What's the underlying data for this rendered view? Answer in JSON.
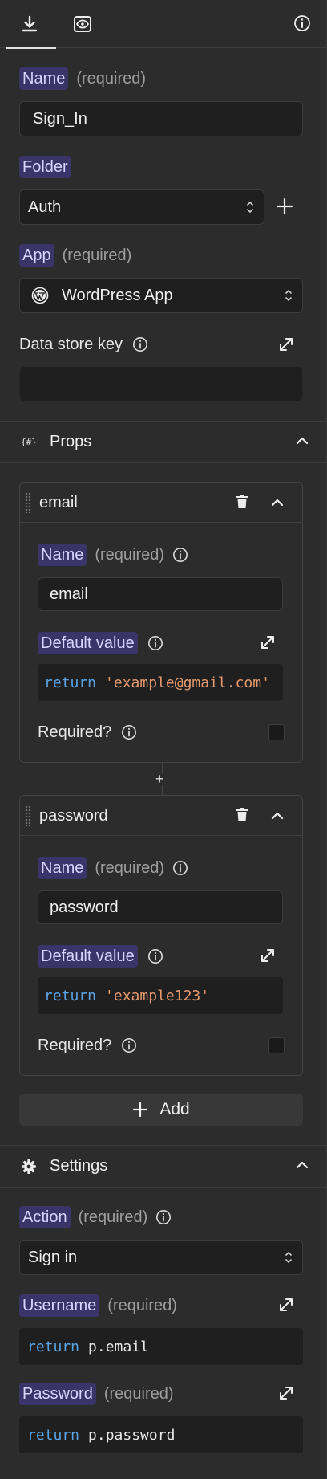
{
  "tabs": [
    {
      "icon": "download-icon"
    },
    {
      "icon": "eye-preview-icon"
    }
  ],
  "info_icon": "info-icon",
  "fields": {
    "name": {
      "label": "Name",
      "hint": "(required)",
      "value": "Sign_In"
    },
    "folder": {
      "label": "Folder",
      "value": "Auth"
    },
    "app": {
      "label": "App",
      "hint": "(required)",
      "value": "WordPress App"
    },
    "data_store_key": {
      "label": "Data store key",
      "value": ""
    }
  },
  "props_section": {
    "title": "Props",
    "icon": "props-braces-icon",
    "props": [
      {
        "title": "email",
        "name_label": "Name",
        "name_hint": "(required)",
        "name_value": "email",
        "default_label": "Default value",
        "default_code": {
          "keyword": "return",
          "string": "'example@gmail.com'"
        },
        "required_label": "Required?"
      },
      {
        "title": "password",
        "name_label": "Name",
        "name_hint": "(required)",
        "name_value": "password",
        "default_label": "Default value",
        "default_code": {
          "keyword": "return",
          "string": "'example123'"
        },
        "required_label": "Required?"
      }
    ],
    "add_label": "Add",
    "add_between": "+"
  },
  "settings_section": {
    "title": "Settings",
    "icon": "gear-icon",
    "action": {
      "label": "Action",
      "hint": "(required)",
      "value": "Sign in"
    },
    "username": {
      "label": "Username",
      "hint": "(required)",
      "code": {
        "keyword": "return",
        "rest": "p.email"
      }
    },
    "password": {
      "label": "Password",
      "hint": "(required)",
      "code": {
        "keyword": "return",
        "rest": "p.password"
      }
    }
  },
  "colors": {
    "background": "#2c2c2c",
    "input_bg": "#1f1f1f",
    "tag_bg": "#3a3468",
    "tag_text": "#d9d3ff",
    "keyword": "#5aa4e6",
    "string": "#e59a6e"
  }
}
